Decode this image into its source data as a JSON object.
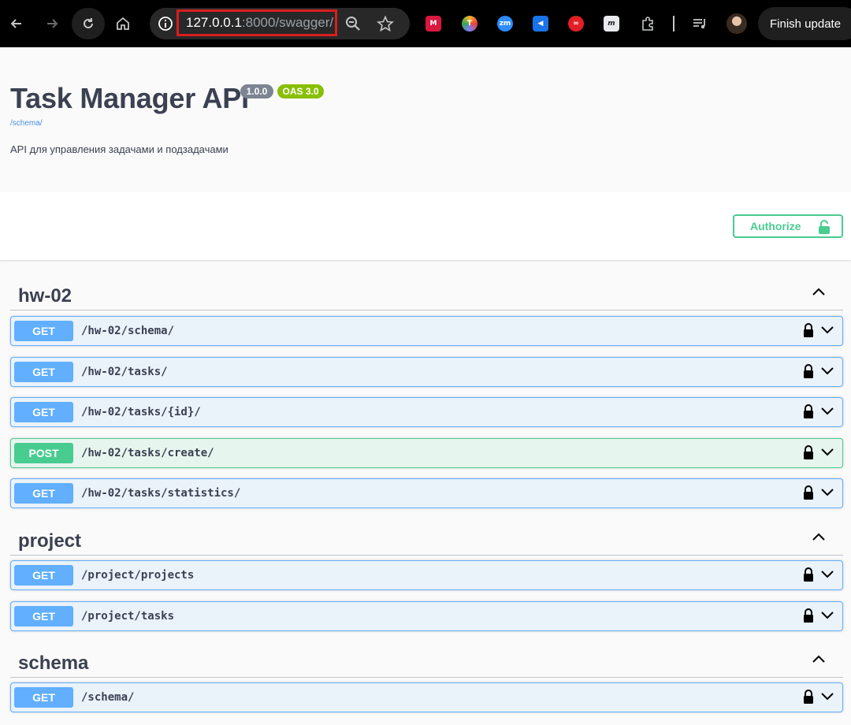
{
  "browser": {
    "url_host": "127.0.0.1",
    "url_rest": ":8000/swagger/",
    "update_button": "Finish update",
    "extensions": [
      {
        "name": "mendeley-icon",
        "color": "#d7183f",
        "glyph": "M"
      },
      {
        "name": "multicolor-t-icon",
        "color": "#7f7cf7",
        "glyph": "T"
      },
      {
        "name": "zoom-icon",
        "color": "#2d8cff",
        "glyph": "zm"
      },
      {
        "name": "megaphone-icon",
        "color": "#1a73e8",
        "glyph": "◀"
      },
      {
        "name": "infinity-icon",
        "color": "#e21f26",
        "glyph": "∞"
      },
      {
        "name": "m-italic-icon",
        "color": "#5f6368",
        "glyph": "m"
      }
    ]
  },
  "info": {
    "title": "Task Manager API",
    "version": "1.0.0",
    "oas": "OAS 3.0",
    "schema_link": "/schema/",
    "description": "API для управления задачами и подзадачами"
  },
  "authorize_label": "Authorize",
  "tags": [
    {
      "name": "hw-02",
      "operations": [
        {
          "method": "GET",
          "path": "/hw-02/schema/"
        },
        {
          "method": "GET",
          "path": "/hw-02/tasks/"
        },
        {
          "method": "GET",
          "path": "/hw-02/tasks/{id}/"
        },
        {
          "method": "POST",
          "path": "/hw-02/tasks/create/"
        },
        {
          "method": "GET",
          "path": "/hw-02/tasks/statistics/"
        }
      ]
    },
    {
      "name": "project",
      "operations": [
        {
          "method": "GET",
          "path": "/project/projects"
        },
        {
          "method": "GET",
          "path": "/project/tasks"
        }
      ]
    },
    {
      "name": "schema",
      "operations": [
        {
          "method": "GET",
          "path": "/schema/"
        }
      ]
    }
  ]
}
